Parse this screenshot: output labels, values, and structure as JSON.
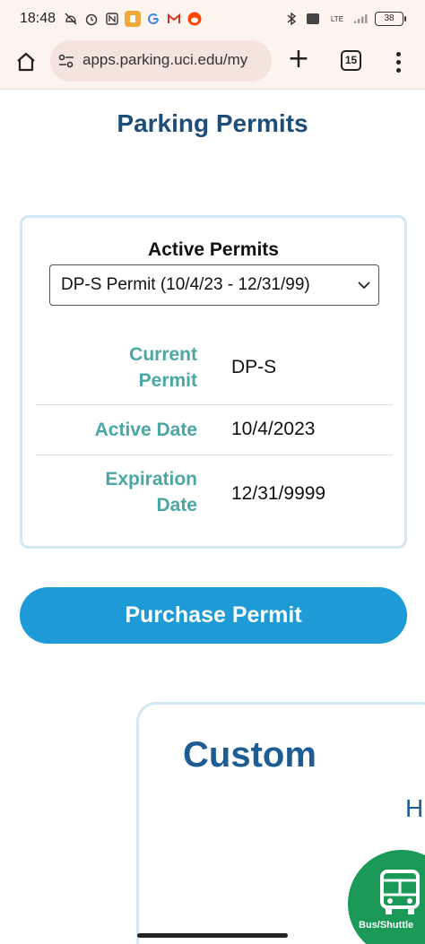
{
  "status_bar": {
    "time": "18:48",
    "network": "LTE",
    "battery": "38"
  },
  "browser": {
    "url": "apps.parking.uci.edu/my",
    "tab_count": "15"
  },
  "page": {
    "title": "Parking Permits"
  },
  "permits": {
    "heading": "Active Permits",
    "selected_option": "DP-S Permit (10/4/23 - 12/31/99)",
    "rows": [
      {
        "label_line1": "Current",
        "label_line2": "Permit",
        "value": "DP-S"
      },
      {
        "label_line1": "Active Date",
        "value": "10/4/2023"
      },
      {
        "label_line1": "Expiration",
        "label_line2": "Date",
        "value": "12/31/9999"
      }
    ]
  },
  "purchase_button": {
    "label": "Purchase Permit"
  },
  "customer_card": {
    "title": "Custom",
    "subtitle": "H",
    "bus_label": "Bus/Shuttle"
  },
  "colors": {
    "title": "#1d4e7a",
    "label_teal": "#4aa7a6",
    "button_blue": "#1e9ad6",
    "card_border": "#d3e8f2",
    "bus_green": "#1a9a56"
  }
}
